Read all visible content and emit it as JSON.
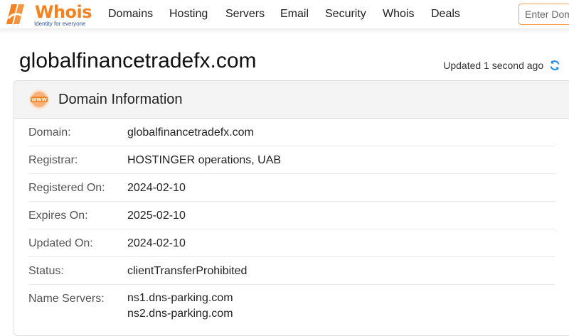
{
  "brand": {
    "name": "Whois",
    "tagline": "Identity for everyone",
    "accent": "#f58220",
    "tagline_color": "#2f5597"
  },
  "nav": {
    "items": [
      {
        "label": "Domains"
      },
      {
        "label": "Hosting"
      },
      {
        "label": "Servers"
      },
      {
        "label": "Email"
      },
      {
        "label": "Security"
      },
      {
        "label": "Whois"
      },
      {
        "label": "Deals"
      }
    ]
  },
  "search": {
    "placeholder": "Enter Domain"
  },
  "page": {
    "title": "globalfinancetradefx.com",
    "updated": "Updated 1 second ago"
  },
  "domain_info": {
    "title": "Domain Information",
    "icon": "www-icon",
    "rows": [
      {
        "label": "Domain:",
        "value": "globalfinancetradefx.com"
      },
      {
        "label": "Registrar:",
        "value": "HOSTINGER operations, UAB"
      },
      {
        "label": "Registered On:",
        "value": "2024-02-10"
      },
      {
        "label": "Expires On:",
        "value": "2025-02-10"
      },
      {
        "label": "Updated On:",
        "value": "2024-02-10"
      },
      {
        "label": "Status:",
        "value": "clientTransferProhibited"
      }
    ],
    "name_servers": {
      "label": "Name Servers:",
      "values": [
        "ns1.dns-parking.com",
        "ns2.dns-parking.com"
      ]
    }
  }
}
